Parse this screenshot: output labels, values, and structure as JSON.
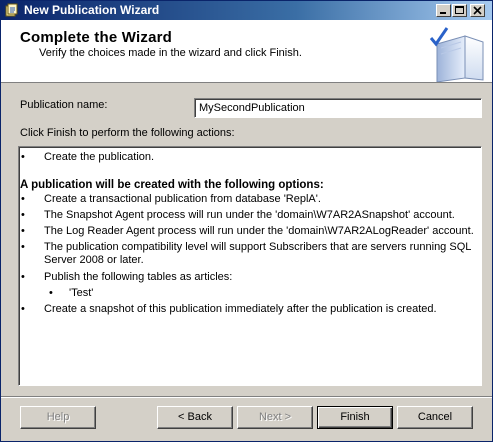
{
  "window": {
    "title": "New Publication Wizard"
  },
  "header": {
    "title": "Complete the Wizard",
    "subtitle": "Verify the choices made in the wizard and click Finish."
  },
  "form": {
    "publication_name_label": "Publication name:",
    "publication_name_value": "MySecondPublication",
    "actions_label": "Click Finish to perform the following actions:"
  },
  "actions": {
    "items": [
      {
        "bullet": "•",
        "text": "Create the publication."
      },
      {
        "heading": "A publication will be created with the following options:"
      },
      {
        "bullet": "•",
        "text": "Create a transactional publication from database 'ReplA'."
      },
      {
        "bullet": "•",
        "text": "The Snapshot Agent process will run under the 'domain\\W7AR2ASnapshot' account."
      },
      {
        "bullet": "•",
        "text": "The Log Reader Agent process will run under the 'domain\\W7AR2ALogReader' account."
      },
      {
        "bullet": "•",
        "text": "The publication compatibility level will support Subscribers that are servers running SQL",
        "text2": "Server 2008 or later."
      },
      {
        "bullet": "•",
        "text": "Publish the following tables as articles:"
      },
      {
        "bullet": "•",
        "text": "'Test'"
      },
      {
        "bullet": "•",
        "text": "Create a snapshot of this publication immediately after the publication is created."
      }
    ]
  },
  "buttons": {
    "help": "Help",
    "back": "< Back",
    "next": "Next >",
    "finish": "Finish",
    "cancel": "Cancel"
  },
  "icons": {
    "app": "wizard-app-icon",
    "header_image": "wizard-book-check-icon",
    "minimize": "minimize-icon",
    "maximize": "maximize-icon",
    "close": "close-icon"
  }
}
